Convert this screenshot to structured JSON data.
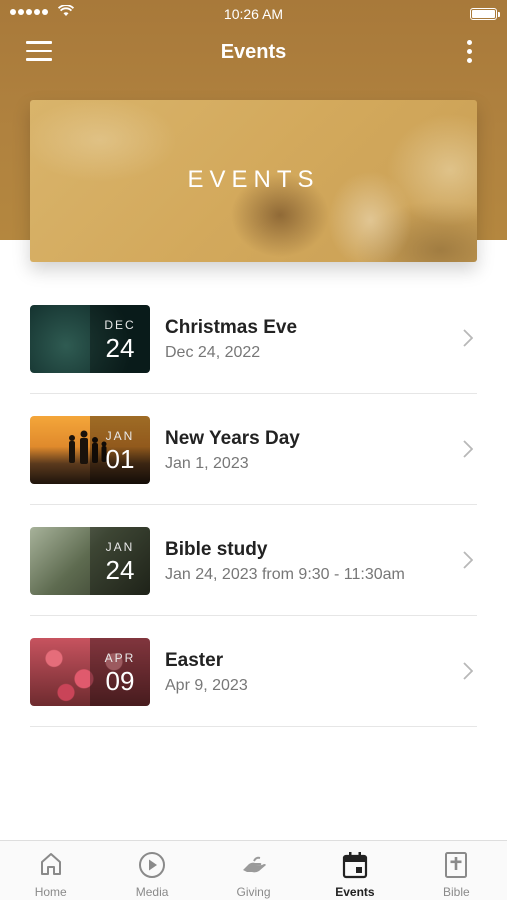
{
  "status_bar": {
    "time": "10:26 AM"
  },
  "nav": {
    "title": "Events"
  },
  "hero": {
    "title": "EVENTS"
  },
  "events": [
    {
      "month": "DEC",
      "day": "24",
      "title": "Christmas Eve",
      "date": "Dec 24, 2022"
    },
    {
      "month": "JAN",
      "day": "01",
      "title": "New Years Day",
      "date": "Jan 1, 2023"
    },
    {
      "month": "JAN",
      "day": "24",
      "title": "Bible study",
      "date": "Jan 24, 2023 from 9:30 - 11:30am"
    },
    {
      "month": "APR",
      "day": "09",
      "title": "Easter",
      "date": "Apr 9, 2023"
    }
  ],
  "tabs": [
    {
      "label": "Home",
      "icon": "home-icon"
    },
    {
      "label": "Media",
      "icon": "play-icon"
    },
    {
      "label": "Giving",
      "icon": "giving-hand-icon"
    },
    {
      "label": "Events",
      "icon": "calendar-icon",
      "active": true
    },
    {
      "label": "Bible",
      "icon": "bible-icon"
    }
  ],
  "colors": {
    "header": "#a8793a",
    "hero": "#d3a95c",
    "active_tab": "#222222",
    "inactive_tab": "#8a8a8a"
  }
}
